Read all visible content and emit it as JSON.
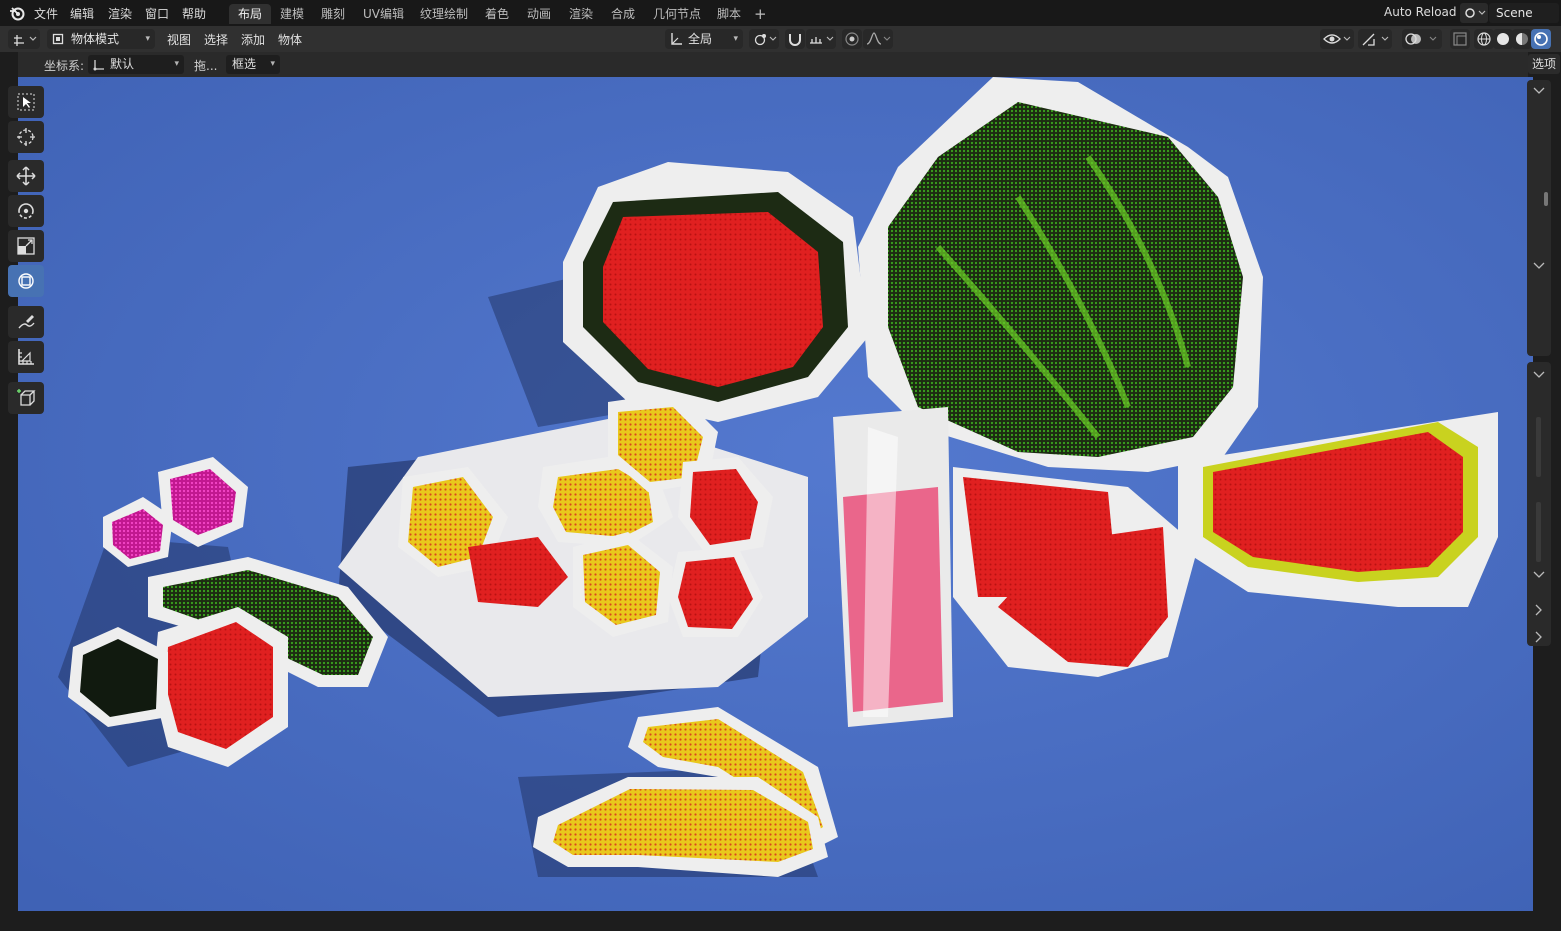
{
  "menu": {
    "file": "文件",
    "edit": "编辑",
    "render": "渲染",
    "window": "窗口",
    "help": "帮助"
  },
  "workspaces": [
    "布局",
    "建模",
    "雕刻",
    "UV编辑",
    "纹理绘制",
    "着色",
    "动画",
    "渲染",
    "合成",
    "几何节点",
    "脚本"
  ],
  "workspace_add": "+",
  "top_right": {
    "auto_reload": "Auto Reload",
    "scene": "Scene"
  },
  "header": {
    "mode": "物体模式",
    "view": "视图",
    "select": "选择",
    "add": "添加",
    "object": "物体",
    "transform_orientation": "全局"
  },
  "tool_settings": {
    "orientation_label": "坐标系:",
    "orientation_value": "默认",
    "drag_label": "拖...",
    "drag_value": "框选",
    "options": "选项"
  },
  "tools": [
    "select-box-icon",
    "cursor-icon",
    "move-icon",
    "rotate-icon",
    "scale-icon",
    "transform-icon",
    "annotate-icon",
    "measure-icon",
    "add-cube-icon"
  ],
  "active_tool": "transform-icon",
  "colors": {
    "accent": "#4772b3",
    "viewport_bg": "#4a6fc0",
    "topbar": "#181818",
    "header": "#303030"
  }
}
